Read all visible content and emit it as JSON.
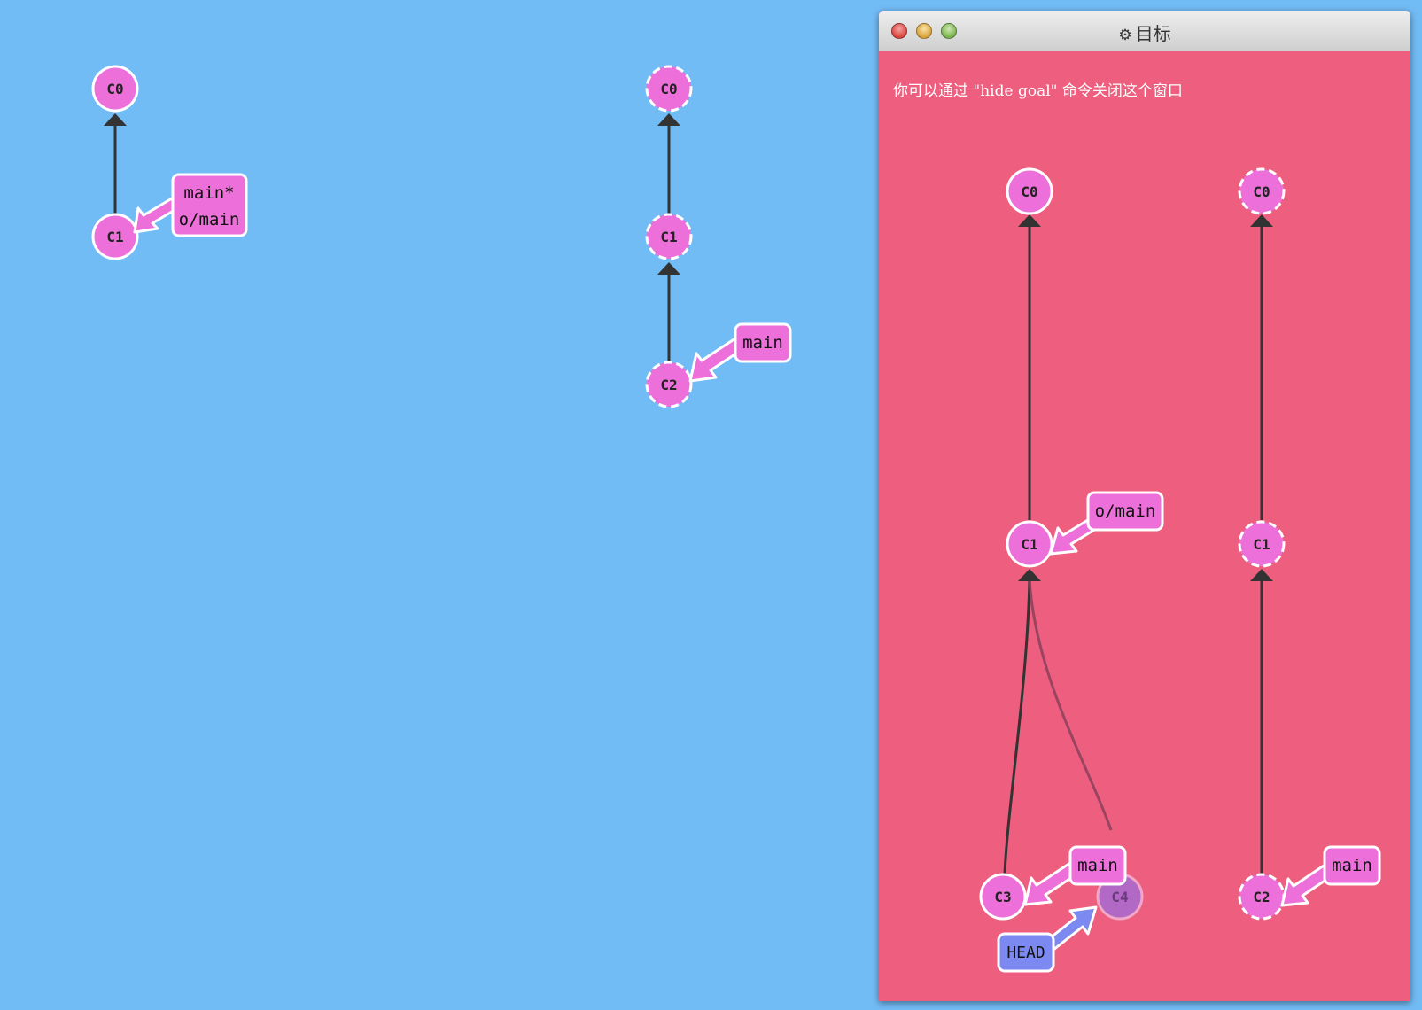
{
  "left_panel": {
    "local_tree": {
      "commits": {
        "c0": "C0",
        "c1": "C1"
      },
      "branch_label": {
        "line1": "main*",
        "line2": "o/main"
      }
    },
    "remote_tree": {
      "commits": {
        "c0": "C0",
        "c1": "C1",
        "c2": "C2"
      },
      "branch_label": "main"
    }
  },
  "goal_window": {
    "title": "目标",
    "title_icon": "gear-icon",
    "hint": "你可以通过 \"hide goal\" 命令关闭这个窗口",
    "local_tree": {
      "commits": {
        "c0": "C0",
        "c1": "C1",
        "c3": "C3",
        "c4": "C4"
      },
      "o_main_label": "o/main",
      "main_label": "main",
      "head_label": "HEAD"
    },
    "remote_tree": {
      "commits": {
        "c0": "C0",
        "c1": "C1",
        "c2": "C2"
      },
      "main_label": "main"
    }
  },
  "colors": {
    "background": "#72bcf6",
    "goal_background": "#ee5e7e",
    "commit_fill": "#ed6fd9",
    "commit_stroke": "#ffffff",
    "branch_fill": "#ed6fd9",
    "head_fill": "#7b89f1",
    "edge": "#333333",
    "ghost_commit_fill": "#b169c5"
  }
}
